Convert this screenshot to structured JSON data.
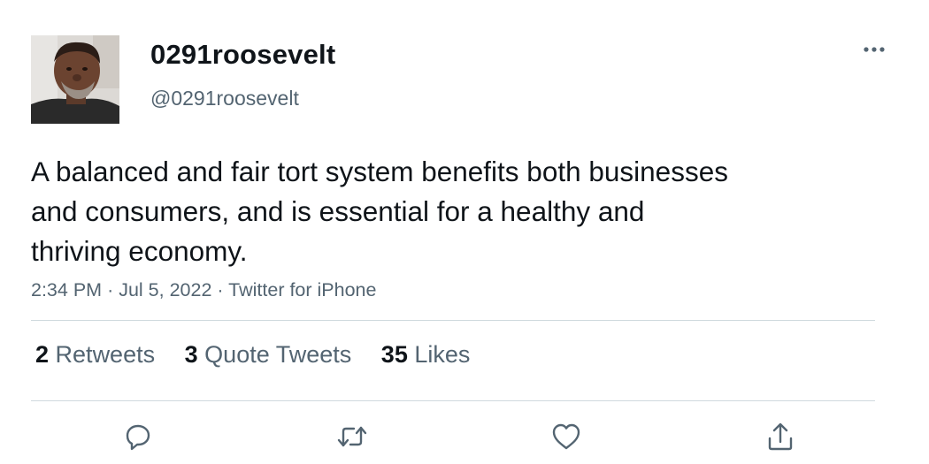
{
  "author": {
    "display_name": "0291roosevelt",
    "handle": "@0291roosevelt"
  },
  "tweet": {
    "text": "A balanced and fair tort system benefits both businesses and consumers, and is essential for a healthy and thriving economy.",
    "time": "2:34 PM",
    "date": "Jul 5, 2022",
    "source": "Twitter for iPhone",
    "separator": "·"
  },
  "stats": {
    "retweets": {
      "count": "2",
      "label": "Retweets"
    },
    "quote_tweets": {
      "count": "3",
      "label": "Quote Tweets"
    },
    "likes": {
      "count": "35",
      "label": "Likes"
    }
  },
  "icons": {
    "more": "more-horizontal-icon",
    "reply": "reply-icon",
    "retweet": "retweet-icon",
    "like": "heart-icon",
    "share": "share-icon"
  },
  "colors": {
    "text_primary": "#0f1419",
    "text_secondary": "#536471",
    "divider": "#cfd9de"
  }
}
